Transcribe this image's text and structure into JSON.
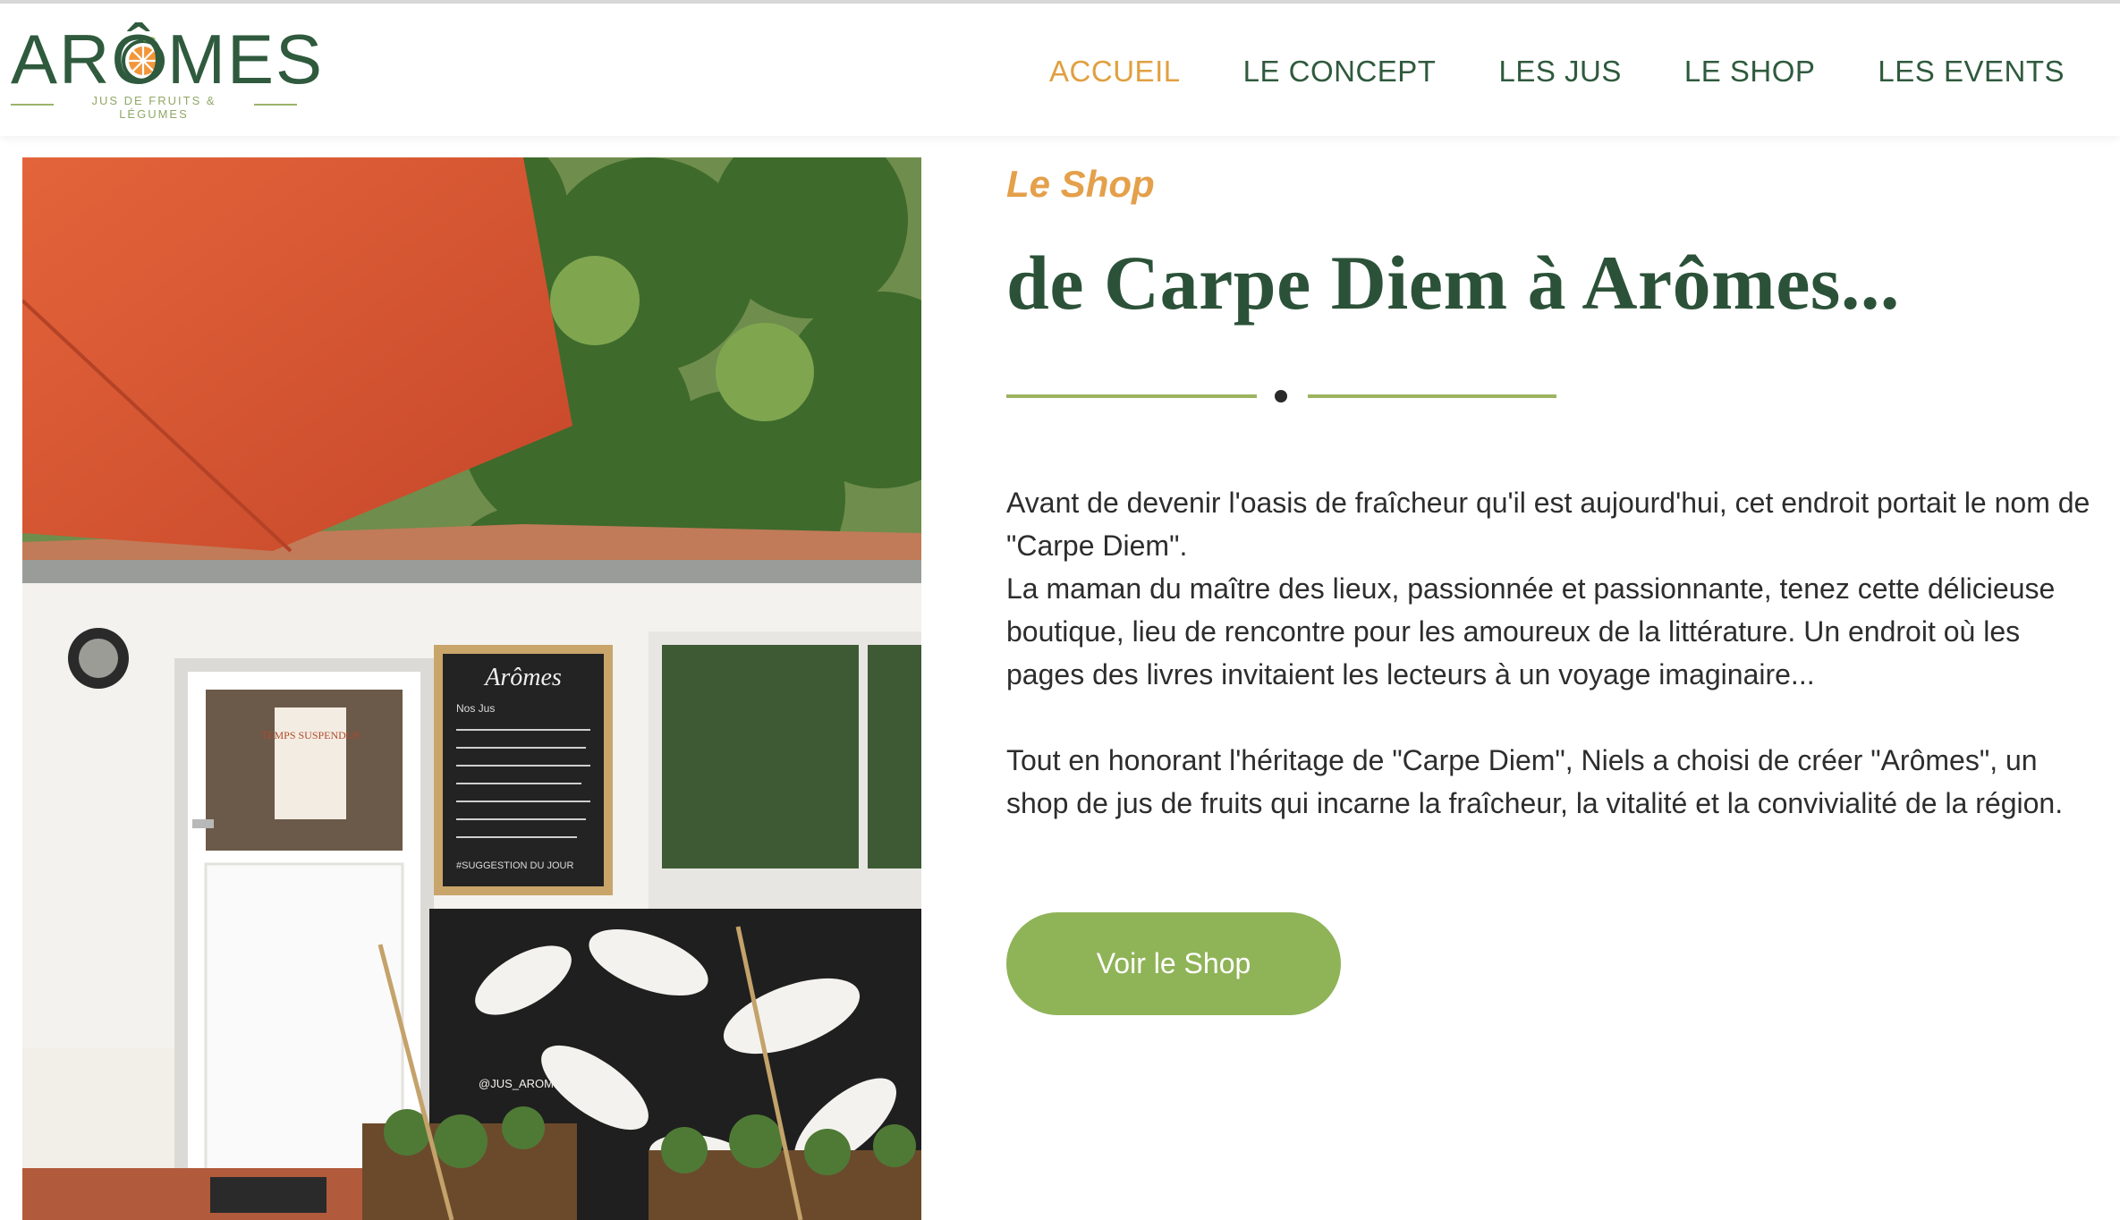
{
  "brand": {
    "name": "ARÔMES",
    "tagline": "JUS DE FRUITS & LÉGUMES"
  },
  "nav": {
    "items": [
      {
        "label": "ACCUEIL",
        "active": true
      },
      {
        "label": "LE CONCEPT",
        "active": false
      },
      {
        "label": "LES JUS",
        "active": false
      },
      {
        "label": "LE SHOP",
        "active": false
      },
      {
        "label": "LES EVENTS",
        "active": false
      }
    ]
  },
  "photo": {
    "door_poster": "TEMPS SUSPENDUS",
    "chalkboard_title": "Arômes",
    "chalkboard_subtitle": "Nos Jus",
    "chalkboard_footer": "#SUGGESTION DU JOUR",
    "wall_tag": "@JUS_AROMES"
  },
  "section": {
    "kicker": "Le Shop",
    "title": "de Carpe Diem à Arômes...",
    "para1": "Avant de devenir l'oasis de fraîcheur qu'il est aujourd'hui, cet endroit portait le nom de \"Carpe Diem\".\nLa maman du maître des lieux, passionnée et passionnante, tenez cette délicieuse boutique, lieu de rencontre pour les amoureux de la littérature. Un endroit où les pages des livres invitaient les lecteurs à un voyage imaginaire...",
    "para2": "Tout en honorant l'héritage de \"Carpe Diem\", Niels a choisi de créer \"Arômes\", un shop de jus de fruits qui incarne la fraîcheur, la vitalité et la convivialité de la région.",
    "cta": "Voir le Shop"
  },
  "colors": {
    "primary_green": "#2f5a3d",
    "accent_orange": "#e0a040",
    "button_green": "#8fb357",
    "divider_green": "#9cb460"
  }
}
